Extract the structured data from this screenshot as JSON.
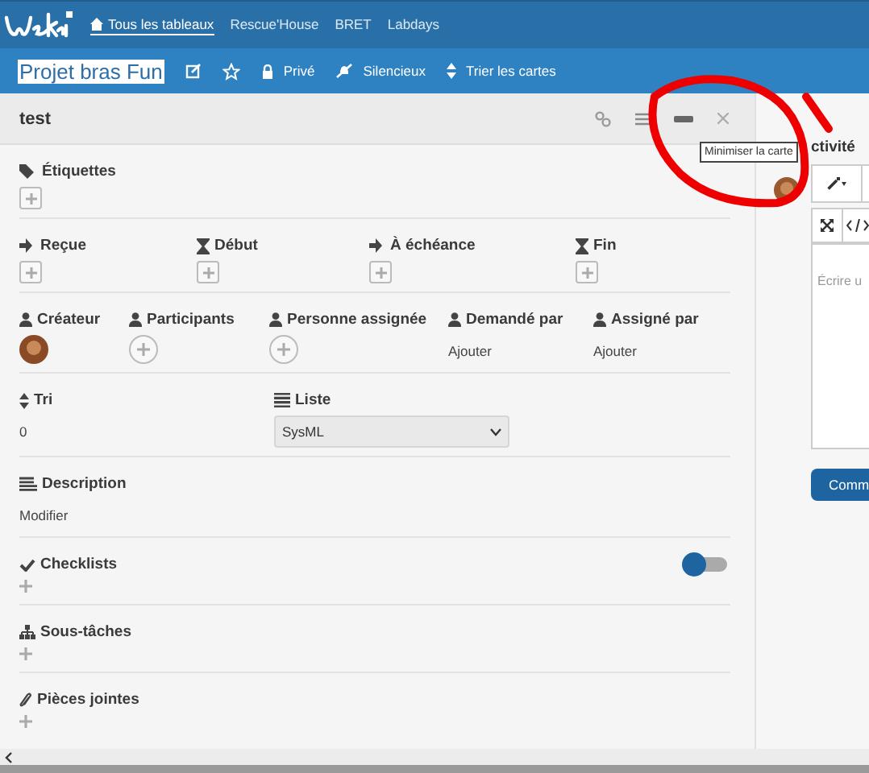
{
  "nav": {
    "boards": [
      {
        "label": "Tous les tableaux",
        "selected": true
      },
      {
        "label": "Rescue'House",
        "selected": false
      },
      {
        "label": "BRET",
        "selected": false
      },
      {
        "label": "Labdays",
        "selected": false
      }
    ]
  },
  "board_header": {
    "title": "Projet bras Fun",
    "title_selected": true,
    "actions": [
      "Privé",
      "Silencieux",
      "Trier les cartes"
    ]
  },
  "card": {
    "title": "test",
    "tooltip": "Minimiser la carte",
    "labels_section": {
      "label": "Étiquettes"
    },
    "dates": [
      "Reçue",
      "Début",
      "À échéance",
      "Fin"
    ],
    "people": [
      {
        "label": "Créateur",
        "kind": "avatar"
      },
      {
        "label": "Participants",
        "kind": "add"
      },
      {
        "label": "Personne assignée",
        "kind": "add"
      },
      {
        "label": "Demandé par",
        "kind": "text",
        "value": "Ajouter"
      },
      {
        "label": "Assigné par",
        "kind": "text",
        "value": "Ajouter"
      }
    ],
    "sort": {
      "label": "Tri",
      "value": "0"
    },
    "list": {
      "label": "Liste",
      "value": "SysML"
    },
    "description": {
      "label": "Description",
      "value": "Modifier"
    },
    "checklists": {
      "label": "Checklists",
      "toggle_on": false
    },
    "subtasks": {
      "label": "Sous-tâches"
    },
    "attachments": {
      "label": "Pièces jointes"
    }
  },
  "activity": {
    "title": "ctivité",
    "placeholder": "Écrire u",
    "button": "Comm"
  }
}
